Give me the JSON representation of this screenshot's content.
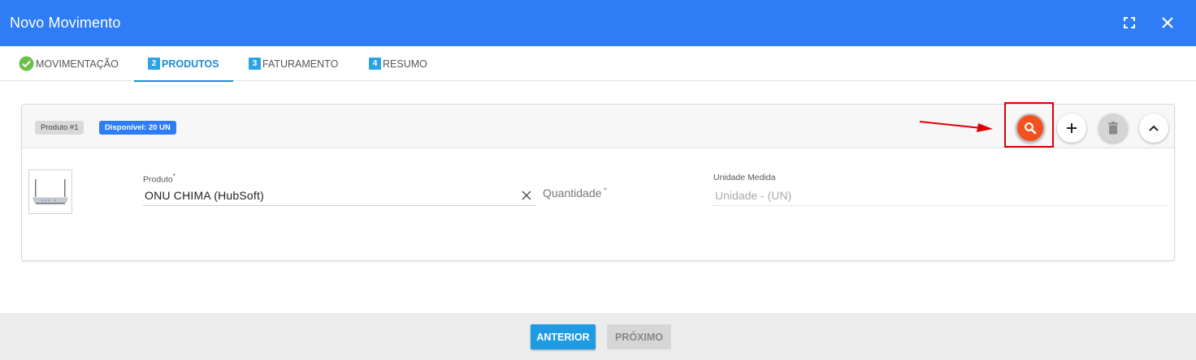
{
  "window": {
    "title": "Novo Movimento",
    "fullscreen_icon": "fullscreen-icon",
    "close_icon": "close-icon"
  },
  "tabs": [
    {
      "label": "MOVIMENTAÇÃO",
      "marker": "check-circle-icon",
      "state": "done"
    },
    {
      "number": "2",
      "label": "PRODUTOS",
      "state": "active"
    },
    {
      "number": "3",
      "label": "FATURAMENTO",
      "state": "pending"
    },
    {
      "number": "4",
      "label": "RESUMO",
      "state": "pending"
    }
  ],
  "product_card": {
    "badge_product": "Produto #1",
    "badge_available": "Disponível: 20 UN",
    "actions": [
      "search-icon",
      "plus-icon",
      "trash-icon",
      "chevron-up-icon"
    ],
    "product_label": "Produto",
    "required_mark": "*",
    "product_value": "ONU CHIMA  (HubSoft)",
    "quantity_placeholder": "Quantidade",
    "unit_label": "Unidade Medida",
    "unit_value": "Unidade - (UN)"
  },
  "footer": {
    "prev_label": "ANTERIOR",
    "next_label": "PRÓXIMO"
  },
  "colors": {
    "header": "#2f7df6",
    "tab_active": "#1a8bd6",
    "search_button": "#f4511e",
    "highlight": "#e00000",
    "prev_button": "#1f9be3"
  }
}
